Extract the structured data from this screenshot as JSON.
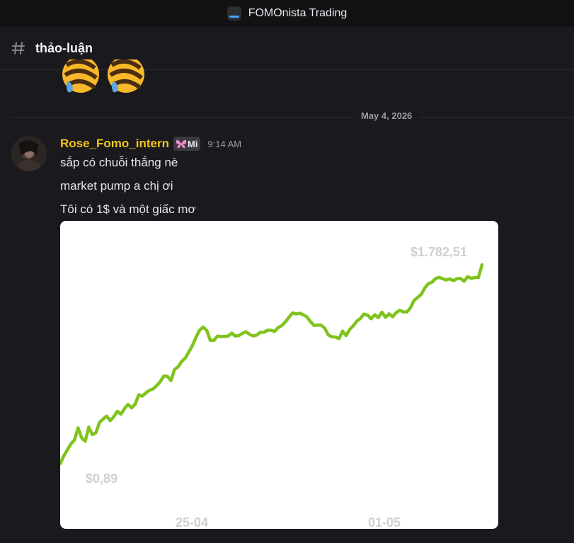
{
  "app": {
    "title": "FOMOnista Trading"
  },
  "channel": {
    "name": "thảo-luận"
  },
  "divider": {
    "date": "May 4, 2026"
  },
  "message": {
    "username": "Rose_Fomo_intern",
    "badge": "Mi",
    "time": "9:14 AM",
    "lines": [
      "sắp có chuỗi thắng nè",
      "market pump a chị ơi",
      "Tôi có 1$ và một giấc mơ"
    ]
  },
  "colors": {
    "username": "#f0c419",
    "line": "#7fc31c",
    "label": "#cfcfcf",
    "background": "#1a1a1e"
  },
  "chart_data": {
    "type": "line",
    "title": "",
    "xlabel": "",
    "ylabel": "",
    "x_ticks": [
      "25-04",
      "01-05"
    ],
    "min_label": "$0,89",
    "max_label": "$1.782,51",
    "grid": false,
    "series": [
      {
        "values": [
          0.89,
          1.2,
          1.5,
          1.9,
          2.2,
          3.5,
          2.4,
          2.1,
          3.6,
          2.7,
          2.9,
          4.3,
          4.9,
          5.5,
          4.6,
          5.4,
          6.6,
          5.9,
          7.3,
          8.6,
          7.5,
          8.7,
          12.4,
          11.8,
          13.4,
          14.7,
          15.5,
          17.6,
          20.5,
          25.4,
          25.1,
          21.3,
          32.6,
          36.1,
          44.4,
          50.4,
          63.6,
          81.6,
          112.3,
          145.4,
          164.9,
          145.3,
          99.0,
          99.0,
          116.9,
          114.8,
          115.1,
          117.1,
          130.6,
          117.2,
          119.1,
          129.8,
          138.0,
          124.7,
          117.6,
          121.4,
          135.4,
          134.8,
          146.2,
          146.1,
          139.9,
          162.8,
          173.9,
          200.6,
          239.6,
          283.4,
          272.7,
          279.1,
          264.7,
          244.1,
          203.6,
          176.1,
          178.1,
          177.1,
          158.4,
          122.4,
          113.6,
          112.9,
          105.8,
          141.3,
          119.1,
          150.9,
          174.2,
          206.6,
          229.8,
          271.2,
          260.3,
          226.5,
          263.8,
          236.6,
          292.0,
          239.6,
          272.5,
          244.0,
          286.9,
          313.3,
          294.7,
          293.8,
          345.0,
          456.0,
          511.3,
          572.5,
          736.4,
          864.8,
          915.3,
          1049.9,
          1099.8,
          1049.5,
          997.5,
          1041.7,
          970.7,
          1048.4,
          1054.3,
          947.3,
          1131.2,
          1061.6,
          1099.3,
          1095.3,
          1782.51
        ]
      }
    ]
  }
}
